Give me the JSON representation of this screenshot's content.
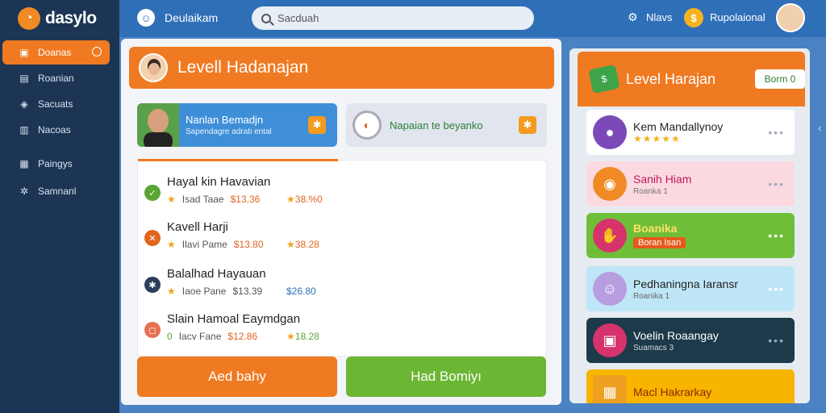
{
  "app": {
    "logo_text": "dasylo",
    "title": "Deulaikam",
    "search_placeholder": "Sacduah",
    "menu_label": "Nlavs",
    "profile_label": "Rupolaional"
  },
  "sidebar": {
    "items": [
      {
        "label": "Doanas",
        "icon": "home-icon"
      },
      {
        "label": "Roanian",
        "icon": "bookmark-icon"
      },
      {
        "label": "Sacuats",
        "icon": "chat-icon"
      },
      {
        "label": "Nacoas",
        "icon": "document-icon"
      },
      {
        "label": "Paingys",
        "icon": "folder-icon"
      },
      {
        "label": "Samnanl",
        "icon": "gear-icon"
      }
    ]
  },
  "main": {
    "title": "Levell Hadanajan",
    "card_a": {
      "title": "Nanlan Bemadjn",
      "subtitle": "Sapendagre adrati ental"
    },
    "card_b": {
      "title": "Napaian te beyanko"
    },
    "rows": [
      {
        "name": "Hayal kin Havavian",
        "meta": "Isad Taae",
        "price1": "$13.36",
        "price2": "38.%0",
        "dot_color": "#5aa534",
        "dot_glyph": "✓"
      },
      {
        "name": "Kavell Harji",
        "meta": "Ilavi Pame",
        "price1": "$13.80",
        "price2": "38.28",
        "dot_color": "#e0661e",
        "dot_glyph": "✕"
      },
      {
        "name": "Balalhad Hayauan",
        "meta": "Iaoe Pane",
        "price1": "$13.39",
        "price2": "$26.80",
        "dot_color": "#2c3e5c",
        "dot_glyph": "✱"
      },
      {
        "name": "Slain Hamoal Eaymdgan",
        "meta": "Iacv Fane",
        "price1": "$12.86",
        "price2": "18.28",
        "dot_color": "#e87050",
        "dot_glyph": "◻"
      }
    ],
    "btn_left": "Aed bahy",
    "btn_right": "Had Bomiyı"
  },
  "right": {
    "title": "Level Harajan",
    "button": "Borm 0",
    "cards": [
      {
        "title": "Kem Mandallynoy",
        "sub": "★★★★★",
        "bg": "#ffffff",
        "fg": "#222222",
        "icon_bg": "#7b4ab8",
        "icon": "●"
      },
      {
        "title": "Sanih Hiam",
        "sub": "Roanka 1",
        "bg": "#fbd9e0",
        "fg": "#c2185b",
        "icon_bg": "#f08a24",
        "icon": "◉"
      },
      {
        "title": "Boanika",
        "sub": "Boran Isan",
        "bg": "#6fbe3a",
        "fg": "#ffe066",
        "icon_bg": "#d6336c",
        "icon": "✋"
      },
      {
        "title": "Pedhaningna Iaransr",
        "sub": "Roanika 1",
        "bg": "#bfe6f7",
        "fg": "#222222",
        "icon_bg": "#b89ee0",
        "icon": "☺"
      },
      {
        "title": "Voelin Roaangay",
        "sub": "Suamacs 3",
        "bg": "#1d3a4a",
        "fg": "#ffffff",
        "icon_bg": "#d6336c",
        "icon": "▣"
      },
      {
        "title": "Macl Hakrarkay",
        "sub": "",
        "bg": "#f7b500",
        "fg": "#8a2a00",
        "icon_bg": "#f0a020",
        "icon": "▦"
      }
    ]
  }
}
